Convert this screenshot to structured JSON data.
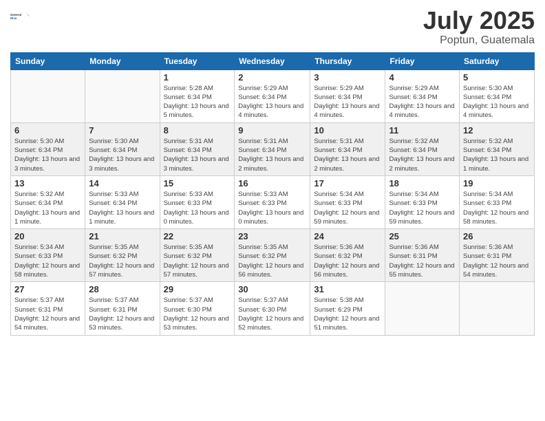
{
  "header": {
    "logo_general": "General",
    "logo_blue": "Blue",
    "month": "July 2025",
    "location": "Poptun, Guatemala"
  },
  "days_of_week": [
    "Sunday",
    "Monday",
    "Tuesday",
    "Wednesday",
    "Thursday",
    "Friday",
    "Saturday"
  ],
  "weeks": [
    [
      {
        "day": "",
        "info": ""
      },
      {
        "day": "",
        "info": ""
      },
      {
        "day": "1",
        "info": "Sunrise: 5:28 AM\nSunset: 6:34 PM\nDaylight: 13 hours and 5 minutes."
      },
      {
        "day": "2",
        "info": "Sunrise: 5:29 AM\nSunset: 6:34 PM\nDaylight: 13 hours and 4 minutes."
      },
      {
        "day": "3",
        "info": "Sunrise: 5:29 AM\nSunset: 6:34 PM\nDaylight: 13 hours and 4 minutes."
      },
      {
        "day": "4",
        "info": "Sunrise: 5:29 AM\nSunset: 6:34 PM\nDaylight: 13 hours and 4 minutes."
      },
      {
        "day": "5",
        "info": "Sunrise: 5:30 AM\nSunset: 6:34 PM\nDaylight: 13 hours and 4 minutes."
      }
    ],
    [
      {
        "day": "6",
        "info": "Sunrise: 5:30 AM\nSunset: 6:34 PM\nDaylight: 13 hours and 3 minutes."
      },
      {
        "day": "7",
        "info": "Sunrise: 5:30 AM\nSunset: 6:34 PM\nDaylight: 13 hours and 3 minutes."
      },
      {
        "day": "8",
        "info": "Sunrise: 5:31 AM\nSunset: 6:34 PM\nDaylight: 13 hours and 3 minutes."
      },
      {
        "day": "9",
        "info": "Sunrise: 5:31 AM\nSunset: 6:34 PM\nDaylight: 13 hours and 2 minutes."
      },
      {
        "day": "10",
        "info": "Sunrise: 5:31 AM\nSunset: 6:34 PM\nDaylight: 13 hours and 2 minutes."
      },
      {
        "day": "11",
        "info": "Sunrise: 5:32 AM\nSunset: 6:34 PM\nDaylight: 13 hours and 2 minutes."
      },
      {
        "day": "12",
        "info": "Sunrise: 5:32 AM\nSunset: 6:34 PM\nDaylight: 13 hours and 1 minute."
      }
    ],
    [
      {
        "day": "13",
        "info": "Sunrise: 5:32 AM\nSunset: 6:34 PM\nDaylight: 13 hours and 1 minute."
      },
      {
        "day": "14",
        "info": "Sunrise: 5:33 AM\nSunset: 6:34 PM\nDaylight: 13 hours and 1 minute."
      },
      {
        "day": "15",
        "info": "Sunrise: 5:33 AM\nSunset: 6:33 PM\nDaylight: 13 hours and 0 minutes."
      },
      {
        "day": "16",
        "info": "Sunrise: 5:33 AM\nSunset: 6:33 PM\nDaylight: 13 hours and 0 minutes."
      },
      {
        "day": "17",
        "info": "Sunrise: 5:34 AM\nSunset: 6:33 PM\nDaylight: 12 hours and 59 minutes."
      },
      {
        "day": "18",
        "info": "Sunrise: 5:34 AM\nSunset: 6:33 PM\nDaylight: 12 hours and 59 minutes."
      },
      {
        "day": "19",
        "info": "Sunrise: 5:34 AM\nSunset: 6:33 PM\nDaylight: 12 hours and 58 minutes."
      }
    ],
    [
      {
        "day": "20",
        "info": "Sunrise: 5:34 AM\nSunset: 6:33 PM\nDaylight: 12 hours and 58 minutes."
      },
      {
        "day": "21",
        "info": "Sunrise: 5:35 AM\nSunset: 6:32 PM\nDaylight: 12 hours and 57 minutes."
      },
      {
        "day": "22",
        "info": "Sunrise: 5:35 AM\nSunset: 6:32 PM\nDaylight: 12 hours and 57 minutes."
      },
      {
        "day": "23",
        "info": "Sunrise: 5:35 AM\nSunset: 6:32 PM\nDaylight: 12 hours and 56 minutes."
      },
      {
        "day": "24",
        "info": "Sunrise: 5:36 AM\nSunset: 6:32 PM\nDaylight: 12 hours and 56 minutes."
      },
      {
        "day": "25",
        "info": "Sunrise: 5:36 AM\nSunset: 6:31 PM\nDaylight: 12 hours and 55 minutes."
      },
      {
        "day": "26",
        "info": "Sunrise: 5:36 AM\nSunset: 6:31 PM\nDaylight: 12 hours and 54 minutes."
      }
    ],
    [
      {
        "day": "27",
        "info": "Sunrise: 5:37 AM\nSunset: 6:31 PM\nDaylight: 12 hours and 54 minutes."
      },
      {
        "day": "28",
        "info": "Sunrise: 5:37 AM\nSunset: 6:31 PM\nDaylight: 12 hours and 53 minutes."
      },
      {
        "day": "29",
        "info": "Sunrise: 5:37 AM\nSunset: 6:30 PM\nDaylight: 12 hours and 53 minutes."
      },
      {
        "day": "30",
        "info": "Sunrise: 5:37 AM\nSunset: 6:30 PM\nDaylight: 12 hours and 52 minutes."
      },
      {
        "day": "31",
        "info": "Sunrise: 5:38 AM\nSunset: 6:29 PM\nDaylight: 12 hours and 51 minutes."
      },
      {
        "day": "",
        "info": ""
      },
      {
        "day": "",
        "info": ""
      }
    ]
  ]
}
